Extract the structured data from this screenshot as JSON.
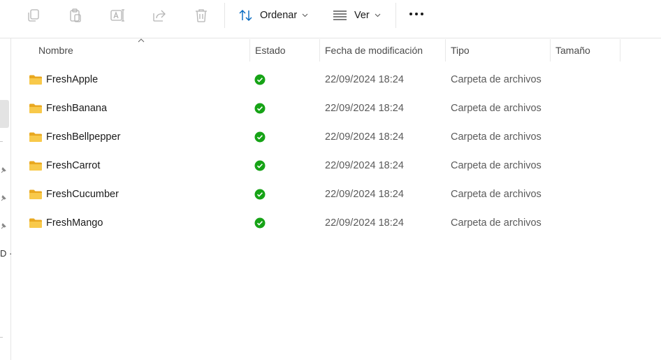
{
  "toolbar": {
    "copy_icon": "copy-icon",
    "paste_icon": "paste-icon",
    "rename_icon": "rename-icon",
    "share_icon": "share-icon",
    "delete_icon": "delete-icon",
    "sort_label": "Ordenar",
    "view_label": "Ver",
    "more_icon": "more-options-icon"
  },
  "nav": {
    "partial_text": "D ·"
  },
  "columns": {
    "name": "Nombre",
    "status": "Estado",
    "modified": "Fecha de modificación",
    "type": "Tipo",
    "size": "Tamaño"
  },
  "rows": [
    {
      "name": "FreshApple",
      "status": "synced",
      "modified": "22/09/2024 18:24",
      "type": "Carpeta de archivos",
      "size": ""
    },
    {
      "name": "FreshBanana",
      "status": "synced",
      "modified": "22/09/2024 18:24",
      "type": "Carpeta de archivos",
      "size": ""
    },
    {
      "name": "FreshBellpepper",
      "status": "synced",
      "modified": "22/09/2024 18:24",
      "type": "Carpeta de archivos",
      "size": ""
    },
    {
      "name": "FreshCarrot",
      "status": "synced",
      "modified": "22/09/2024 18:24",
      "type": "Carpeta de archivos",
      "size": ""
    },
    {
      "name": "FreshCucumber",
      "status": "synced",
      "modified": "22/09/2024 18:24",
      "type": "Carpeta de archivos",
      "size": ""
    },
    {
      "name": "FreshMango",
      "status": "synced",
      "modified": "22/09/2024 18:24",
      "type": "Carpeta de archivos",
      "size": ""
    }
  ],
  "colors": {
    "accent": "#0067c0",
    "folder": "#f8c94a",
    "status_ok": "#16a316",
    "disabled_icon": "#b4b4b4"
  }
}
